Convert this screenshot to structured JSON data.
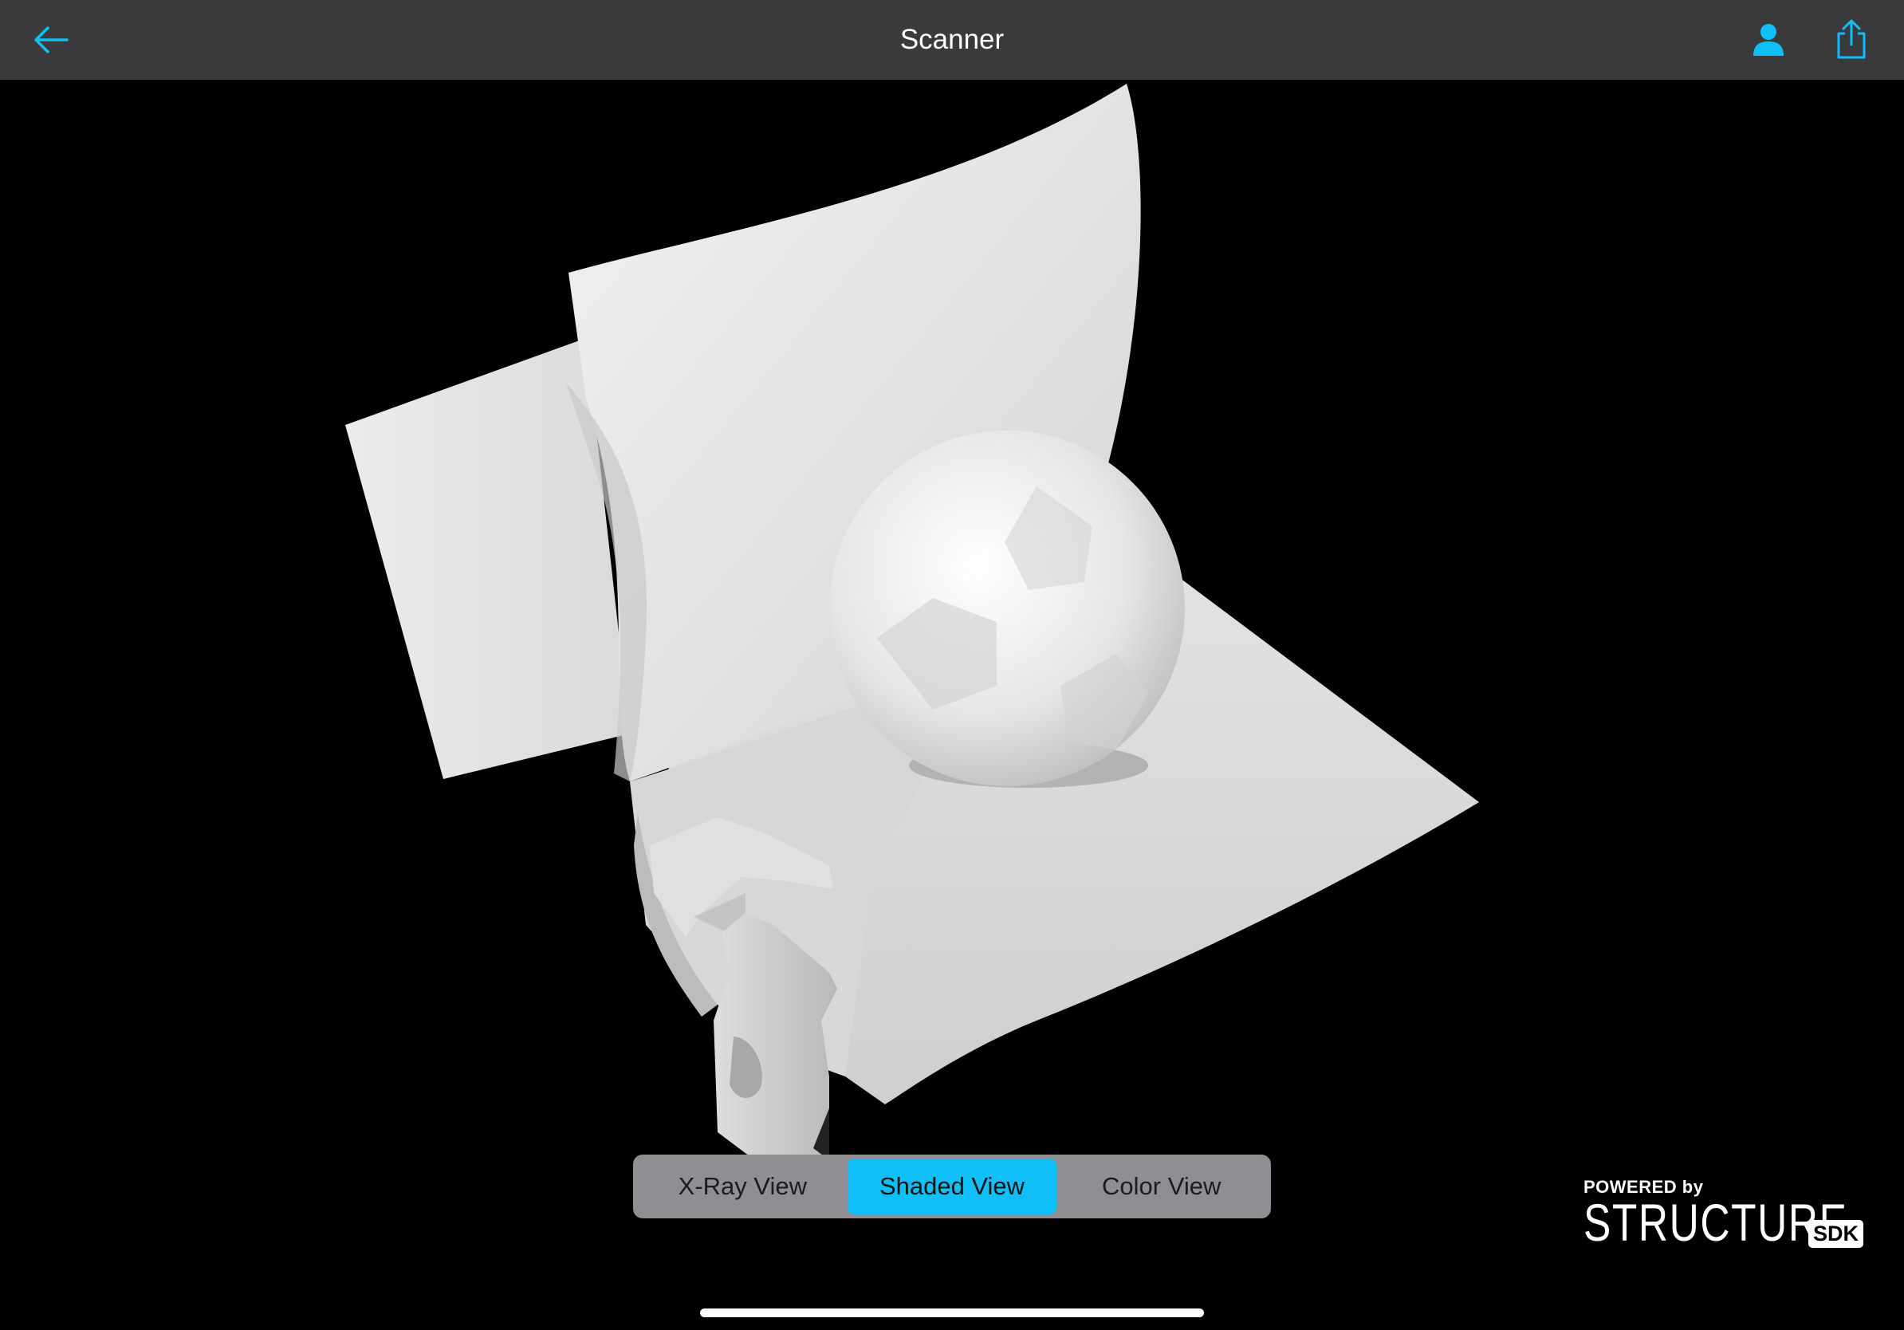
{
  "navbar": {
    "title": "Scanner",
    "back_icon": "back-arrow-icon",
    "user_icon": "person-icon",
    "share_icon": "share-icon",
    "accent_color": "#10bff7",
    "background_color": "#3a3a3c"
  },
  "view_modes": {
    "options": [
      "X-Ray View",
      "Shaded View",
      "Color View"
    ],
    "selected": "Shaded View",
    "selected_color": "#10bff7"
  },
  "branding": {
    "powered_by": "POWERED by",
    "name": "STRUCTURE",
    "suffix": "SDK"
  }
}
